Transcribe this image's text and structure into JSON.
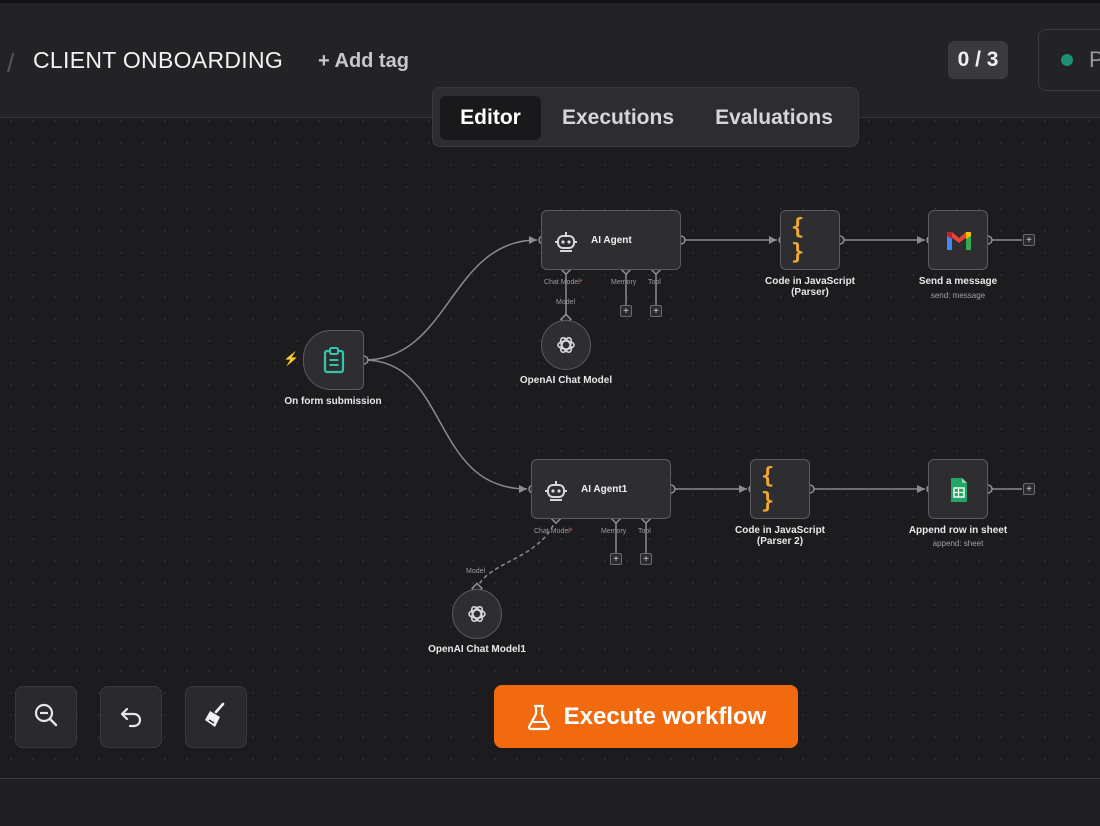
{
  "header": {
    "breadcrumb_separator": "/",
    "workflow_title": "CLIENT ONBOARDING",
    "add_tag_label": "+ Add tag",
    "execution_counter": "0 / 3",
    "publish_label": "P"
  },
  "tabs": [
    {
      "label": "Editor",
      "active": true
    },
    {
      "label": "Executions",
      "active": false
    },
    {
      "label": "Evaluations",
      "active": false
    }
  ],
  "nodes": {
    "trigger": {
      "label": "On form submission",
      "icon": "clipboard-icon"
    },
    "agent1": {
      "label": "AI Agent",
      "icon": "robot-icon",
      "ports": {
        "chat_model": "Chat Model",
        "required_mark": "*",
        "memory": "Memory",
        "tool": "Tool"
      }
    },
    "model1": {
      "label": "OpenAI Chat Model",
      "port_label": "Model",
      "icon": "openai-icon"
    },
    "code1": {
      "label_line1": "Code in JavaScript",
      "label_line2": "(Parser)",
      "icon": "braces-icon"
    },
    "gmail": {
      "label": "Send a message",
      "sub": "send: message",
      "icon": "gmail-icon"
    },
    "agent2": {
      "label": "AI Agent1",
      "icon": "robot-icon",
      "ports": {
        "chat_model": "Chat Model",
        "required_mark": "*",
        "memory": "Memory",
        "tool": "Tool"
      }
    },
    "model2": {
      "label": "OpenAI Chat Model1",
      "port_label": "Model",
      "icon": "openai-icon"
    },
    "code2": {
      "label_line1": "Code in JavaScript",
      "label_line2": "(Parser 2)",
      "icon": "braces-icon"
    },
    "sheets": {
      "label": "Append row in sheet",
      "sub": "append: sheet",
      "icon": "sheets-icon"
    }
  },
  "plus_glyph": "+",
  "controls": {
    "zoom_out": "zoom-out-icon",
    "undo": "undo-icon",
    "clear": "broom-icon"
  },
  "execute_button": {
    "label": "Execute workflow",
    "icon": "flask-icon"
  },
  "colors": {
    "accent": "#f26a0f",
    "trigger_icon": "#35c4b0",
    "code_icon": "#f0a830",
    "sheets_green": "#23a566",
    "status_dot": "#1e8f72"
  }
}
